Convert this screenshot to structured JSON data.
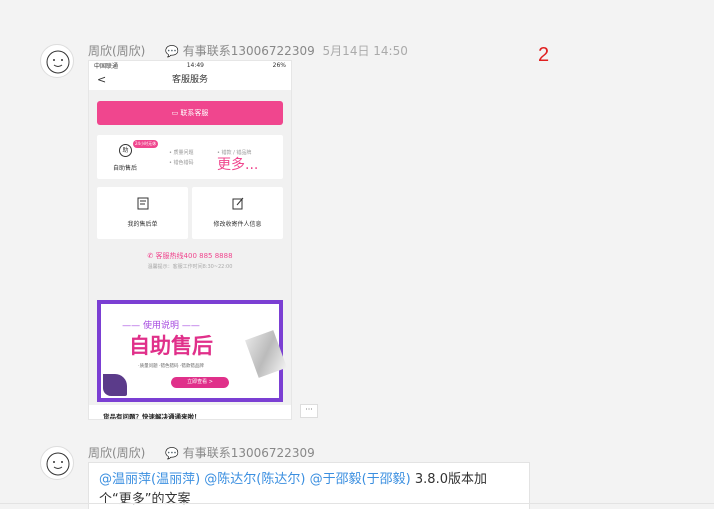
{
  "messages": [
    {
      "sender": "周欣(周欣)",
      "signature": "有事联系13006722309",
      "time": "5月14日 14:50"
    },
    {
      "sender": "周欣(周欣)",
      "signature": "有事联系13006722309",
      "mentions": [
        "@温丽萍(温丽萍)",
        "@陈达尔(陈达尔)",
        "@于邵毅(于邵毅)"
      ],
      "text_tail": "3.8.0版本加个“更多”的文案"
    }
  ],
  "annotation_number": "2",
  "more_button": "···",
  "phone": {
    "status_carrier": "中国联通",
    "status_time": "14:49",
    "status_battery": "26%",
    "nav_back": "<",
    "nav_title": "客服服务",
    "contact_btn": "联系客服",
    "selfservice_tag": "24小时无休",
    "selfservice_icon": "助",
    "selfservice_label": "自助售后",
    "items_col1": [
      "• 质量问题",
      "• 错色错码"
    ],
    "items_col2": "• 错款 / 错品牌",
    "more_text": "更多...",
    "my_aftersale": "我的售后单",
    "edit_info": "修改收寄件人信息",
    "hotline": "客服热线400 885 8888",
    "hours": "温馨提示：客服工作时间8:30~22:00",
    "banner_title": "—— 使用说明 ——",
    "banner_main": "自助售后",
    "banner_sub": "·质量问题 ·错色错码 ·错款错品牌",
    "banner_btn": "立即查看 >",
    "footer": "货品有问题？快速解决通通来啦！"
  }
}
